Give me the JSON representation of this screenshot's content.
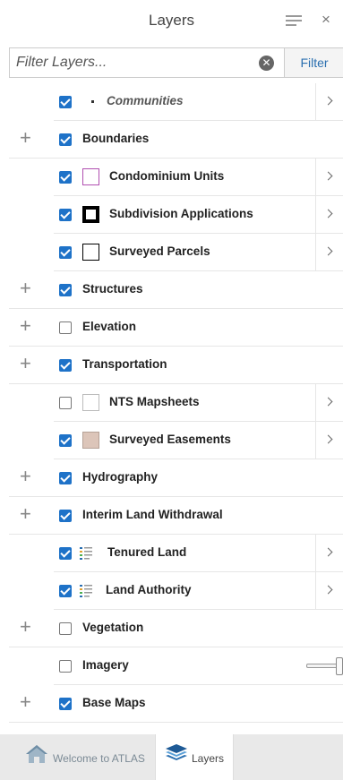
{
  "header": {
    "title": "Layers",
    "close_glyph": "×"
  },
  "filter": {
    "placeholder": "Filter Layers...",
    "value": "",
    "button_label": "Filter",
    "clear_glyph": "✕"
  },
  "colors": {
    "accent": "#1e72c8",
    "filter_text": "#2a6fb0"
  },
  "layers": {
    "communities": "Communities",
    "boundaries": "Boundaries",
    "condominium_units": "Condominium Units",
    "subdivision_applications": "Subdivision Applications",
    "surveyed_parcels": "Surveyed Parcels",
    "structures": "Structures",
    "elevation": "Elevation",
    "transportation": "Transportation",
    "nts_mapsheets": "NTS Mapsheets",
    "surveyed_easements": "Surveyed Easements",
    "hydrography": "Hydrography",
    "interim_land_withdrawal": "Interim Land Withdrawal",
    "tenured_land": "Tenured Land",
    "land_authority": "Land Authority",
    "vegetation": "Vegetation",
    "imagery": "Imagery",
    "base_maps": "Base Maps"
  },
  "imagery_opacity": 1.0,
  "tabs": {
    "welcome": "Welcome to ATLAS",
    "layers": "Layers"
  },
  "icons": {
    "menu": "hamburger-menu-icon",
    "home": "house-icon",
    "layers": "layers-stack-icon",
    "expand": "plus-icon",
    "details": "chevron-right-icon"
  }
}
